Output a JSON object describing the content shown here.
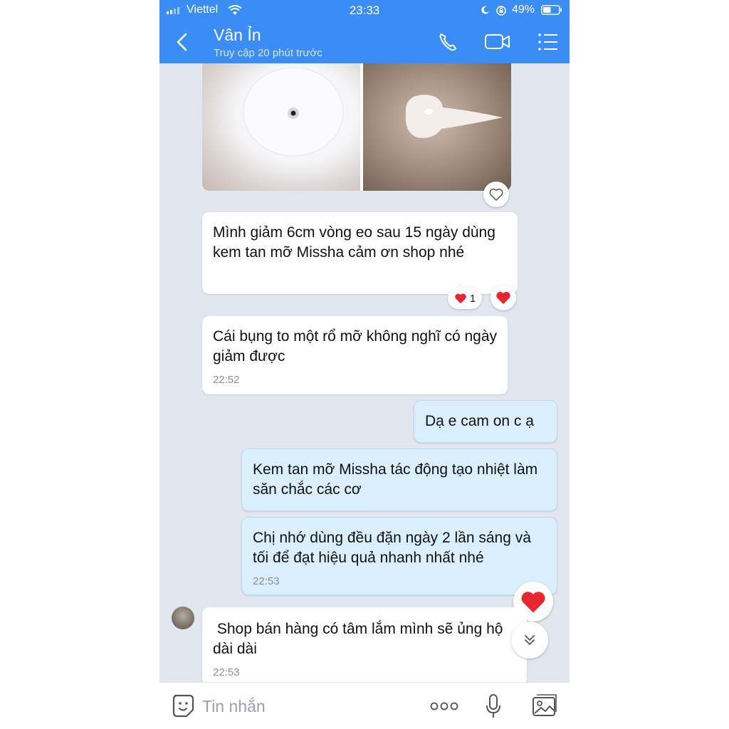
{
  "status_bar": {
    "carrier": "Viettel",
    "time": "23:33",
    "battery": "49%"
  },
  "header": {
    "name": "Vân Ỉn",
    "status": "Truy cập 20 phút trước"
  },
  "messages": [
    {
      "text": "Mình giảm 6cm vòng eo sau 15 ngày dùng kem tan mỡ Missha cảm ơn shop nhé",
      "reaction_count": "1"
    },
    {
      "text": "Cái bụng to một rổ mỡ không nghĩ có ngày giảm được",
      "time": "22:52"
    },
    {
      "text": "Dạ e cam on c ạ"
    },
    {
      "text": "Kem tan mỡ Missha tác động tạo nhiệt làm săn chắc các cơ"
    },
    {
      "text": "Chị nhớ dùng đều đặn ngày 2 lần sáng và tối để đạt hiệu quả nhanh nhất nhé",
      "time": "22:53"
    },
    {
      "text": " Shop bán hàng có tâm lắm mình sẽ ủng hộ dài dài",
      "time": "22:53"
    }
  ],
  "input_bar": {
    "placeholder": "Tin nhắn"
  },
  "colors": {
    "header": "#3a8df5",
    "background": "#e2e7ef",
    "outgoing_bubble": "#d9effd",
    "incoming_bubble": "#ffffff",
    "heart": "#e8262f"
  },
  "icons": {
    "header": [
      "back-arrow-icon",
      "phone-icon",
      "video-camera-icon",
      "list-menu-icon"
    ],
    "input": [
      "sticker-icon",
      "more-dots-icon",
      "microphone-icon",
      "image-icon"
    ]
  }
}
